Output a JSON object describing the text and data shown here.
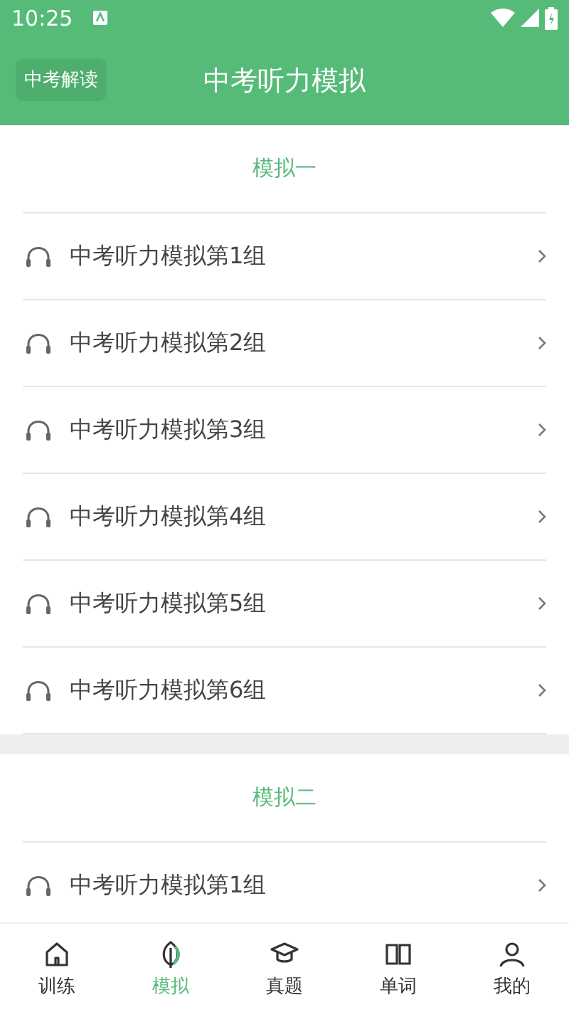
{
  "status_bar": {
    "time": "10:25"
  },
  "app_bar": {
    "left_button": "中考解读",
    "title": "中考听力模拟"
  },
  "sections": [
    {
      "title": "模拟一",
      "items": [
        "中考听力模拟第1组",
        "中考听力模拟第2组",
        "中考听力模拟第3组",
        "中考听力模拟第4组",
        "中考听力模拟第5组",
        "中考听力模拟第6组"
      ]
    },
    {
      "title": "模拟二",
      "items": [
        "中考听力模拟第1组"
      ]
    }
  ],
  "bottom_nav": [
    {
      "label": "训练",
      "kind": "home",
      "selected": false
    },
    {
      "label": "模拟",
      "kind": "leaf",
      "selected": true
    },
    {
      "label": "真题",
      "kind": "cap",
      "selected": false
    },
    {
      "label": "单词",
      "kind": "book",
      "selected": false
    },
    {
      "label": "我的",
      "kind": "person",
      "selected": false
    }
  ]
}
